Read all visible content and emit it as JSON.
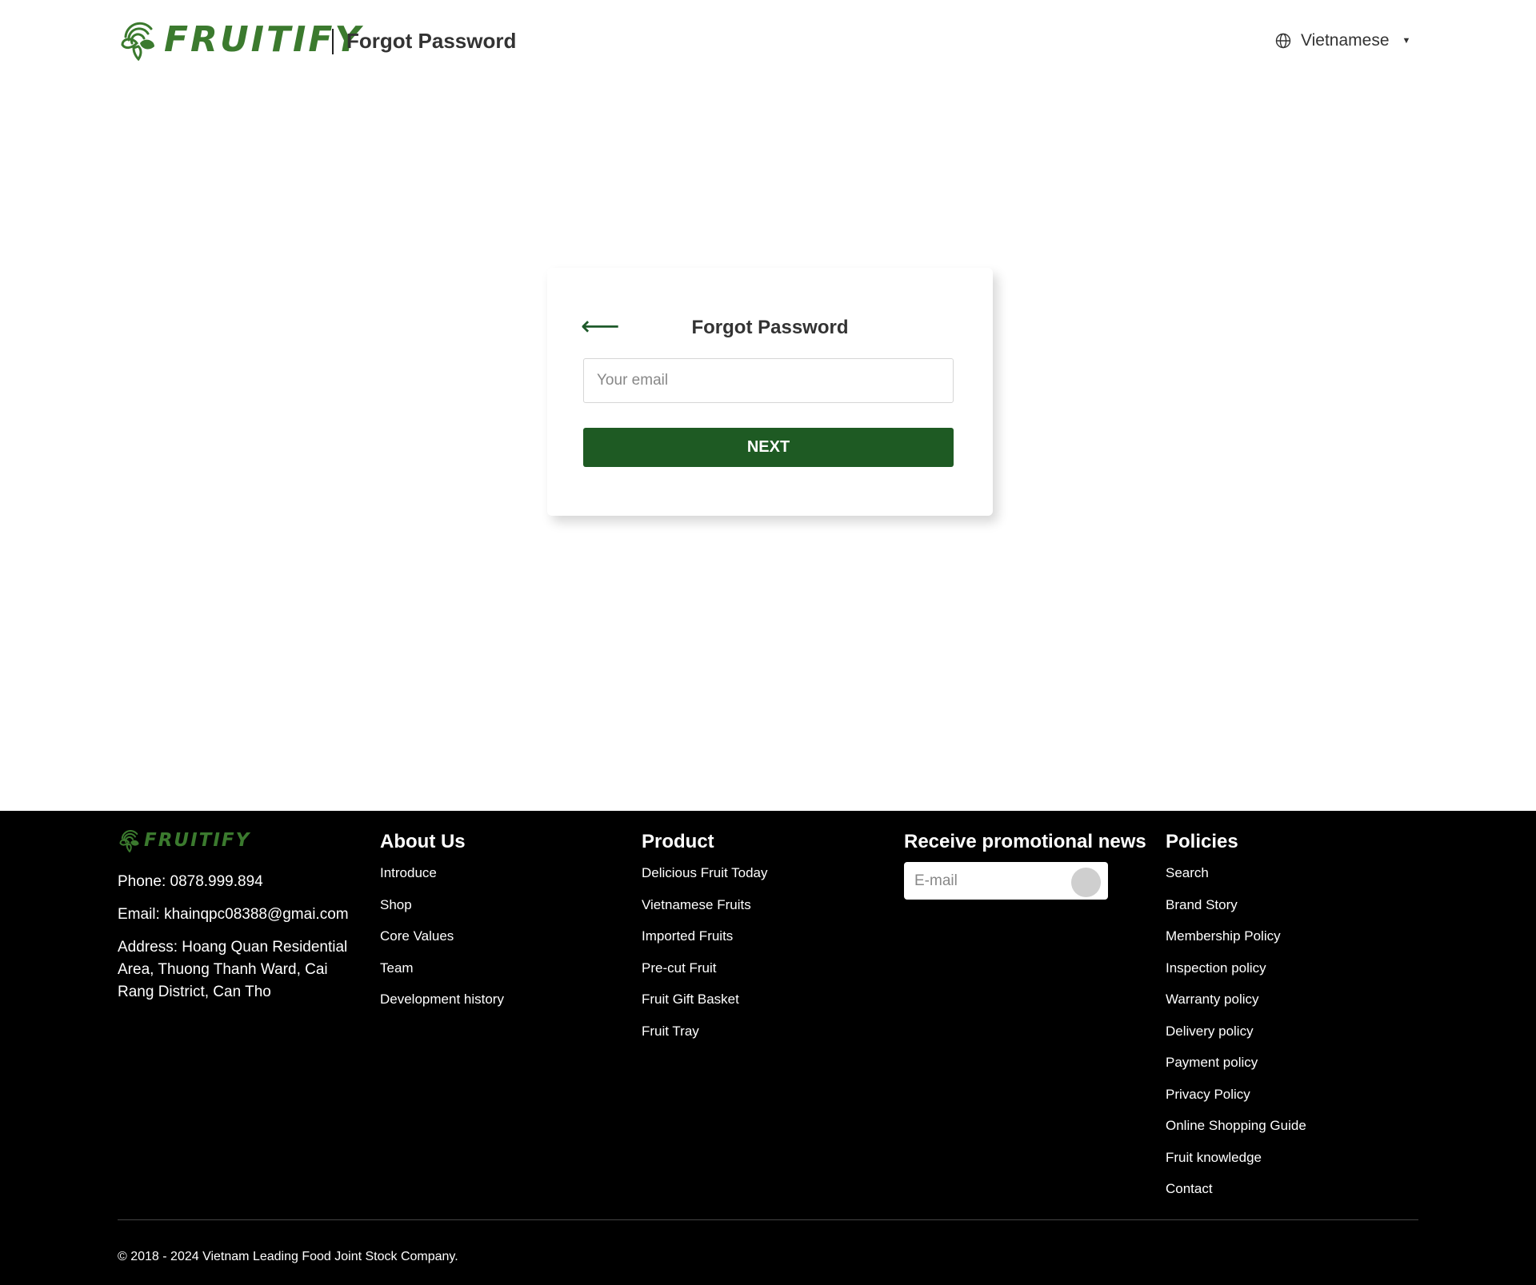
{
  "header": {
    "brand": "FRUITIFY",
    "title": "Forgot Password",
    "language": "Vietnamese"
  },
  "card": {
    "title": "Forgot Password",
    "email_placeholder": "Your email",
    "next_label": "NEXT"
  },
  "footer": {
    "brand": "FRUITIFY",
    "phone": "Phone: 0878.999.894",
    "email": "Email: khainqpc08388@gmai.com",
    "address": "Address: Hoang Quan Residential Area, Thuong Thanh Ward, Cai Rang District, Can Tho",
    "about": {
      "heading": "About Us",
      "items": [
        "Introduce",
        "Shop",
        "Core Values",
        "Team",
        "Development history"
      ]
    },
    "product": {
      "heading": "Product",
      "items": [
        "Delicious Fruit Today",
        "Vietnamese Fruits",
        "Imported Fruits",
        "Pre-cut Fruit",
        "Fruit Gift Basket",
        "Fruit Tray"
      ]
    },
    "promo": {
      "heading": "Receive promotional news",
      "placeholder": "E-mail"
    },
    "policies": {
      "heading": "Policies",
      "items": [
        "Search",
        "Brand Story",
        "Membership Policy",
        "Inspection policy",
        "Warranty policy",
        "Delivery policy",
        "Payment policy",
        "Privacy Policy",
        "Online Shopping Guide",
        "Fruit knowledge",
        "Contact"
      ]
    },
    "copyright": "© 2018 - 2024 Vietnam Leading Food Joint Stock Company."
  },
  "colors": {
    "brand_green": "#3b7a2e",
    "button_green": "#1e5a23",
    "footer_bg": "#000000"
  },
  "icons": {
    "logo": "leaf-wifi-logo-icon",
    "language": "globe-icon",
    "dropdown": "caret-down-icon",
    "back": "arrow-left-icon"
  }
}
